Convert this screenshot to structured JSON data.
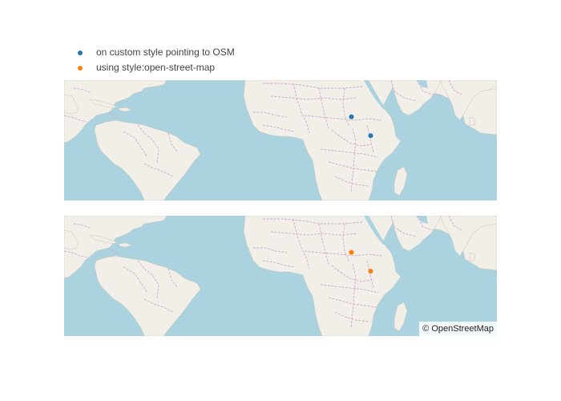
{
  "legend": {
    "items": [
      {
        "label": "on custom style pointing to OSM",
        "color": "#1f77b4"
      },
      {
        "label": "using style:open-street-map",
        "color": "#ff7f0e"
      }
    ]
  },
  "maps": [
    {
      "name": "on custom style pointing to OSM",
      "style": "custom tile source (OpenStreetMap)",
      "marker_color": "#1f77b4",
      "points": [
        {
          "lat": 16.0,
          "lon": 14.5
        },
        {
          "lat": 8.0,
          "lon": 22.5
        }
      ]
    },
    {
      "name": "using style:open-street-map",
      "style": "open-street-map",
      "marker_color": "#ff7f0e",
      "points": [
        {
          "lat": 16.0,
          "lon": 14.5
        },
        {
          "lat": 8.0,
          "lon": 22.5
        }
      ]
    }
  ],
  "colors": {
    "ocean": "#aad3df",
    "land": "#f2efe9",
    "border": "#cfa8cf",
    "lake": "#aad3df"
  },
  "attribution": {
    "text": "© OpenStreetMap"
  }
}
